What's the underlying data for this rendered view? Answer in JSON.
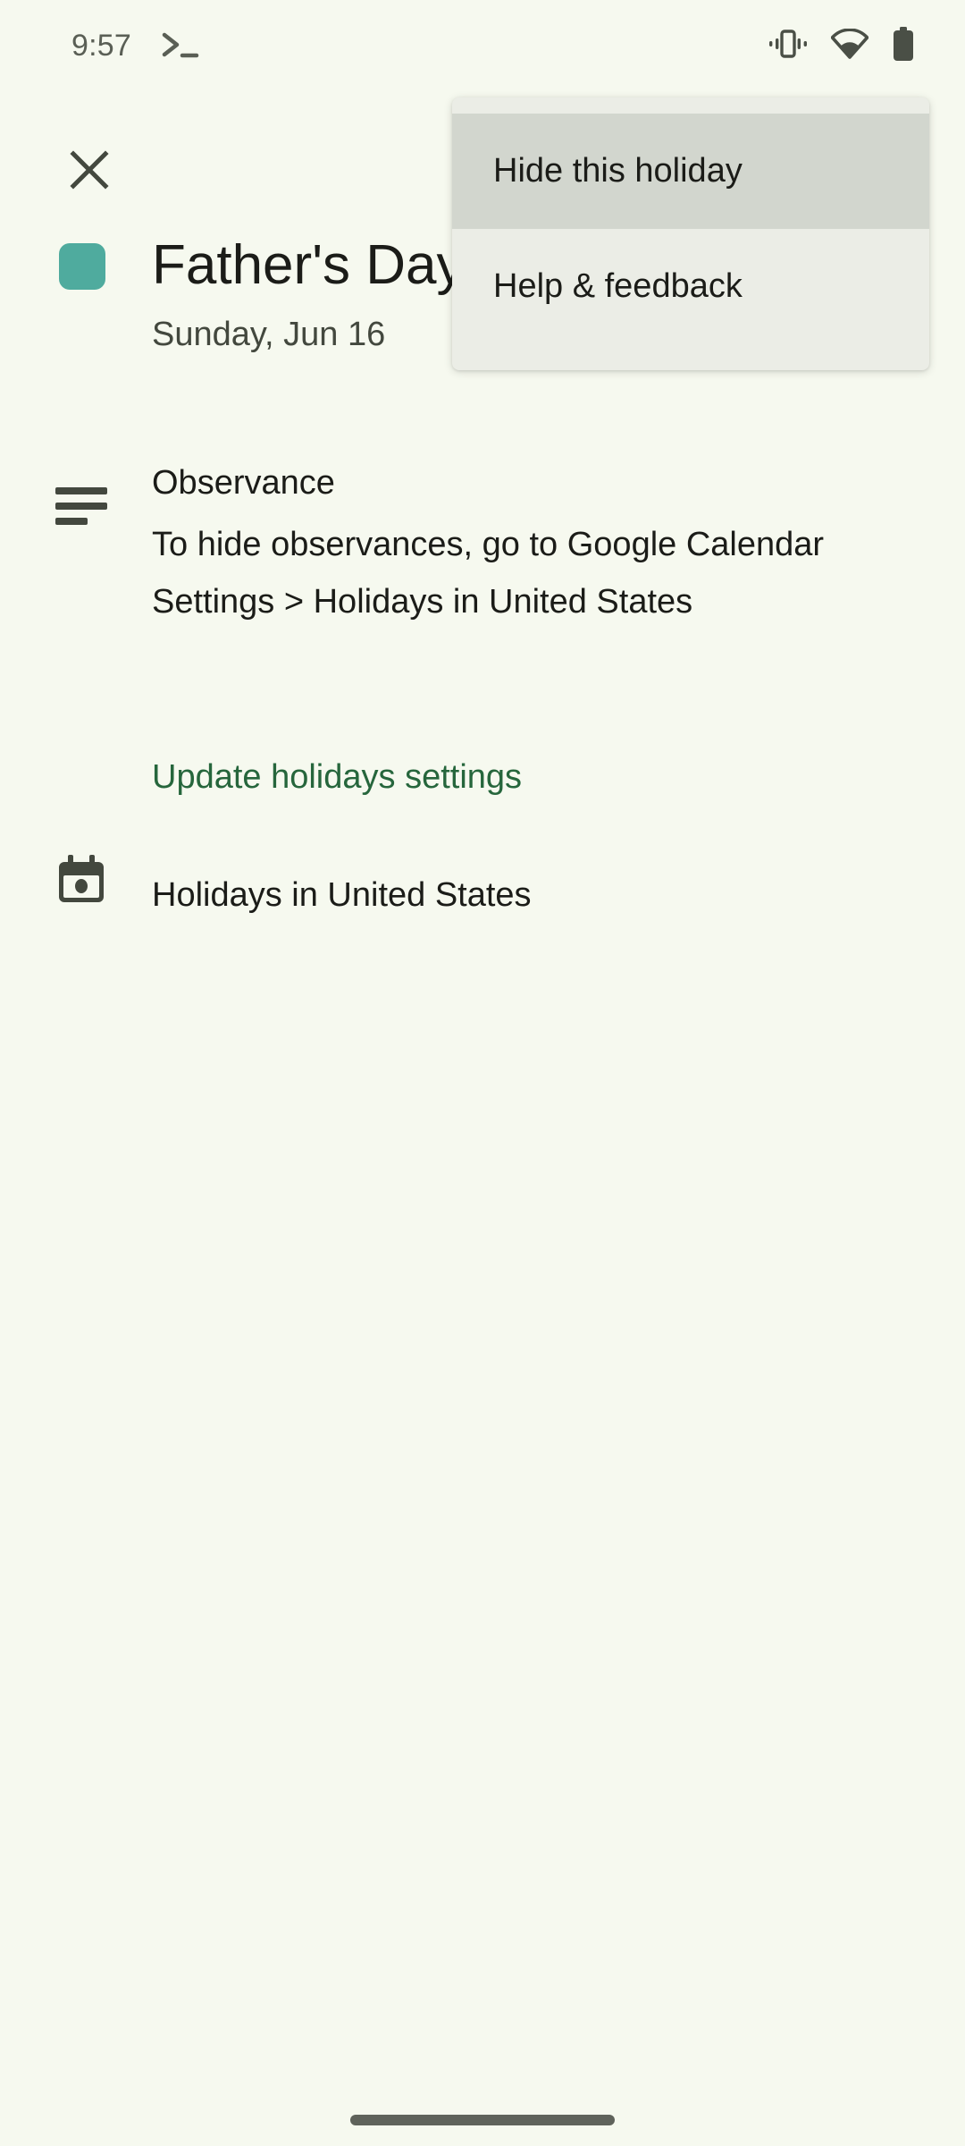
{
  "status_bar": {
    "time": "9:57",
    "icons": [
      "terminal-icon",
      "vibrate-icon",
      "wifi-icon",
      "battery-icon"
    ]
  },
  "toolbar": {
    "close_label": "Close",
    "close_icon": "close-icon"
  },
  "event": {
    "color_hex": "#4FAB9E",
    "title": "Father's Day",
    "date": "Sunday, Jun 16"
  },
  "description": {
    "icon": "description-icon",
    "heading": "Observance",
    "body": "To hide observances, go to Google Calendar Settings > Holidays in United States",
    "link_label": "Update holidays settings",
    "link_color_hex": "#26663C"
  },
  "calendar": {
    "icon": "calendar-event-icon",
    "name": "Holidays in United States"
  },
  "overflow_menu": {
    "items": [
      {
        "label": "Hide this holiday",
        "pressed": true
      },
      {
        "label": "Help & feedback",
        "pressed": false
      }
    ]
  },
  "colors": {
    "background": "#F6F9EF",
    "menu_background": "#EBEDE6",
    "menu_pressed": "#D2D6CE",
    "text_primary": "#1B1C18",
    "text_secondary": "#43483E"
  }
}
